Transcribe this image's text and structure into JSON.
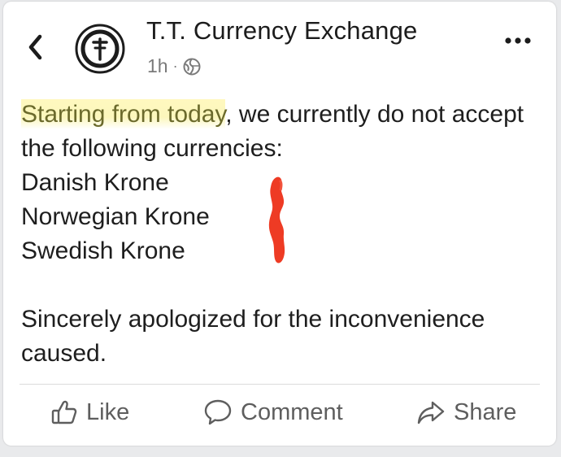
{
  "header": {
    "page_name": "T.T. Currency Exchange",
    "time_ago": "1h",
    "separator": "·",
    "audience_icon": "globe-icon",
    "back_icon": "chevron-left-icon",
    "more_icon": "more-dots-icon"
  },
  "post": {
    "highlighted_intro": "Starting from today",
    "intro_rest": ", we currently do not accept the following currencies:",
    "currencies": [
      "Danish Krone",
      "Norwegian Krone",
      "Swedish Krone"
    ],
    "closing": "Sincerely apologized for the inconvenience caused."
  },
  "actions": {
    "like_label": "Like",
    "comment_label": "Comment",
    "share_label": "Share"
  },
  "colors": {
    "highlight": "#fbf4a8",
    "highlight_text": "#6b6a2c",
    "red_mark": "#ee3b24",
    "text": "#1e1e1e",
    "secondary_text": "#5e5e5e"
  }
}
